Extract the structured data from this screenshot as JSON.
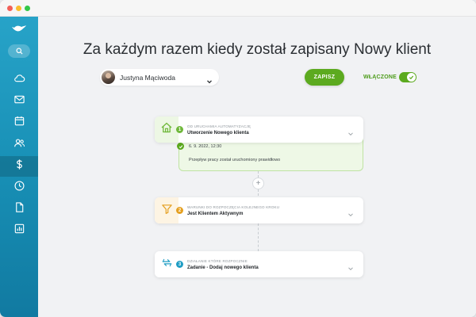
{
  "window": {
    "colors": {
      "close": "#f25f58",
      "minimize": "#fbbd2e",
      "maximize": "#33c748"
    }
  },
  "sidebar": {
    "logo_icon": "bird-logo-icon",
    "search_icon": "search-icon",
    "items": [
      {
        "icon": "cloud-icon",
        "active": false
      },
      {
        "icon": "mail-icon",
        "active": false
      },
      {
        "icon": "calendar-icon",
        "active": false
      },
      {
        "icon": "users-icon",
        "active": false
      },
      {
        "icon": "dollar-icon",
        "active": true
      },
      {
        "icon": "clock-icon",
        "active": false
      },
      {
        "icon": "document-icon",
        "active": false
      },
      {
        "icon": "chart-icon",
        "active": false
      }
    ],
    "gradient": [
      "#27a3c8",
      "#117aa1"
    ]
  },
  "header": {
    "title": "Za każdym razem kiedy został zapisany Nowy klient",
    "user": {
      "name": "Justyna Mąciwoda"
    },
    "save_label": "ZAPISZ",
    "enabled_label": "WŁĄCZONE",
    "enabled": true,
    "accent": "#5caa1f"
  },
  "workflow": {
    "trigger": {
      "number": "1",
      "caption": "OD URUCHAMIA AUTOMATYZACJĘ",
      "title": "Utworzenie Nowego klienta",
      "icon": "home-icon",
      "color": "#6fb83a"
    },
    "success": {
      "date": "6. 9. 2022, 12:30",
      "message": "Przepływ pracy został uruchomiony prawidłowo"
    },
    "add_step_label": "+",
    "condition": {
      "number": "2",
      "caption": "WARUNKI DO ROZPOCZĘCIA KOLEJNEGO KROKU",
      "title": "Jest Klientem Aktywnym",
      "icon": "filter-icon",
      "color": "#e5a021"
    },
    "action": {
      "number": "3",
      "caption": "DZIAŁANIE KTÓRE ROZPOCZNIE",
      "title": "Zadanie - Dodaj nowego klienta",
      "icon": "transfer-icon",
      "color": "#1f9dc4"
    }
  }
}
